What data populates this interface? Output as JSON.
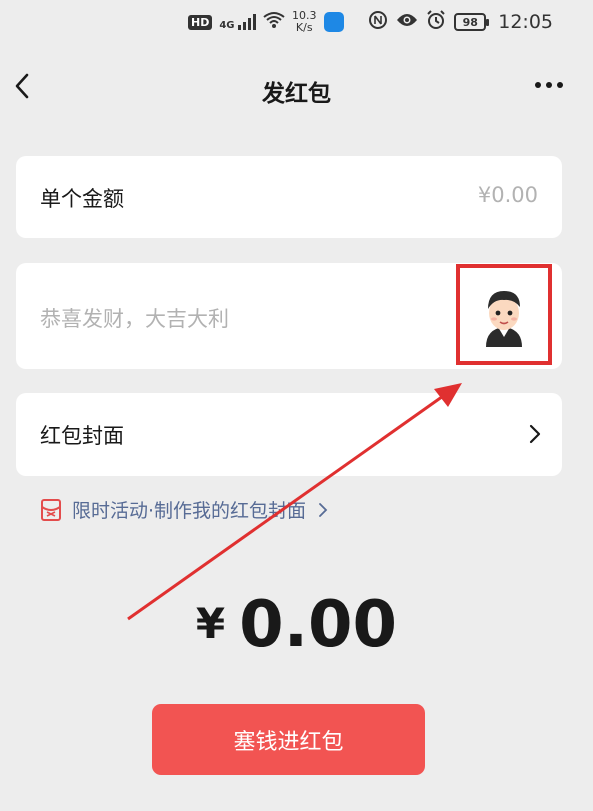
{
  "status_bar": {
    "network_badge": "HD",
    "signal_label": "4G",
    "speed_value": "10.3",
    "speed_unit": "K/s",
    "battery_level": "98",
    "time": "12:05"
  },
  "header": {
    "title": "发红包"
  },
  "amount_card": {
    "label": "单个金额",
    "value": "¥0.00"
  },
  "greeting_card": {
    "placeholder": "恭喜发财，大吉大利",
    "emoji_icon": "avatar-sticker-icon"
  },
  "cover_card": {
    "label": "红包封面"
  },
  "promo": {
    "text": "限时活动·制作我的红包封面"
  },
  "total": {
    "currency": "¥",
    "amount": "0.00"
  },
  "send_button": {
    "label": "塞钱进红包"
  },
  "colors": {
    "background": "#ededed",
    "button": "#f25452",
    "link": "#576b95",
    "annotation": "#e03030"
  }
}
